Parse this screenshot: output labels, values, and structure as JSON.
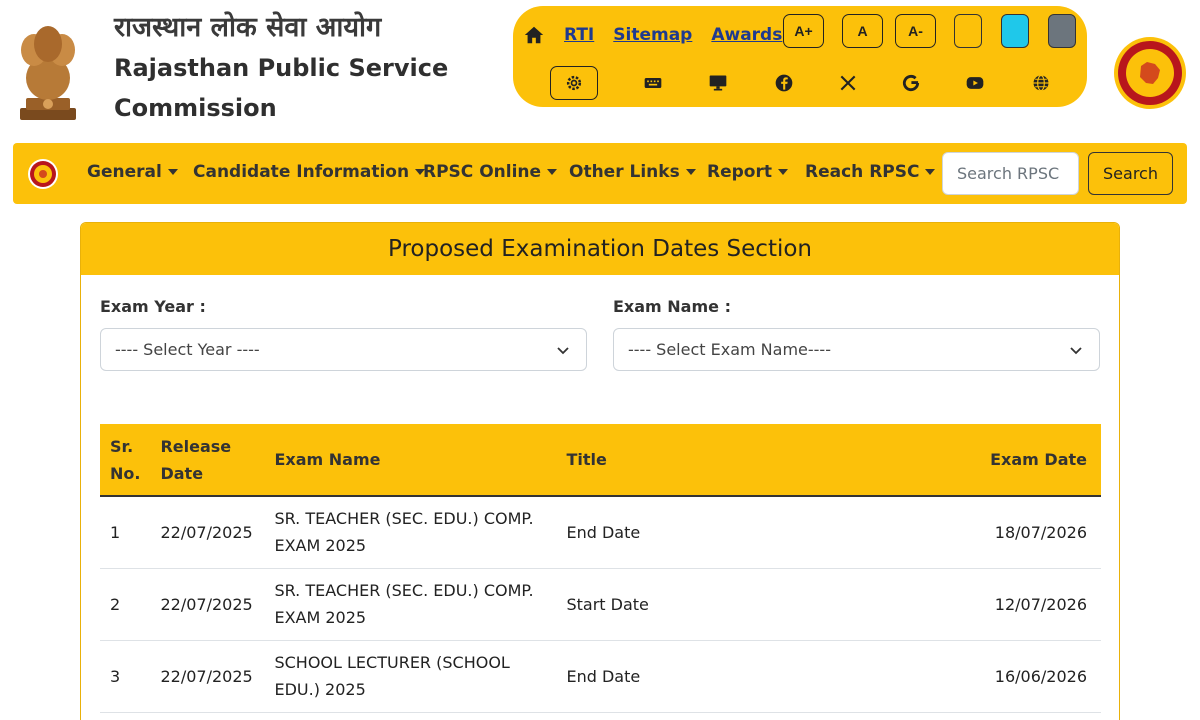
{
  "header": {
    "org_hindi": "राजस्थान लोक सेवा आयोग",
    "org_english": "Rajasthan Public Service Commission"
  },
  "utility": {
    "links": [
      "RTI",
      "Sitemap",
      "Awards"
    ],
    "font_controls": [
      "A+",
      "A",
      "A-"
    ],
    "themes": [
      "#fcc10a",
      "#1fc8ea",
      "#6c757d"
    ],
    "icons": [
      "home-icon",
      "gear-icon",
      "keyboard-icon",
      "monitor-icon",
      "facebook-icon",
      "x-icon",
      "google-icon",
      "youtube-icon",
      "globe-icon"
    ]
  },
  "nav": {
    "items": [
      "General",
      "Candidate Information",
      "RPSC Online",
      "Other Links",
      "Report",
      "Reach RPSC"
    ],
    "search_placeholder": "Search RPSC",
    "search_button": "Search"
  },
  "section": {
    "title": "Proposed Examination Dates Section",
    "exam_year_label": "Exam Year :",
    "exam_year_selected": "---- Select Year ----",
    "exam_name_label": "Exam Name :",
    "exam_name_selected": "---- Select Exam Name----"
  },
  "table": {
    "headers": {
      "sr": "Sr. No.",
      "release": "Release Date",
      "exam_name": "Exam Name",
      "title": "Title",
      "exam_date": "Exam Date"
    },
    "rows": [
      {
        "sr": "1",
        "release": "22/07/2025",
        "exam_name": "SR. TEACHER (SEC. EDU.) COMP. EXAM 2025",
        "title": "End Date",
        "exam_date": "18/07/2026"
      },
      {
        "sr": "2",
        "release": "22/07/2025",
        "exam_name": "SR. TEACHER (SEC. EDU.) COMP. EXAM 2025",
        "title": "Start Date",
        "exam_date": "12/07/2026"
      },
      {
        "sr": "3",
        "release": "22/07/2025",
        "exam_name": "SCHOOL LECTURER (SCHOOL EDU.) 2025",
        "title": "End Date",
        "exam_date": "16/06/2026"
      }
    ]
  },
  "colors": {
    "accent": "#fcc10a",
    "link": "#1f3a8f"
  }
}
